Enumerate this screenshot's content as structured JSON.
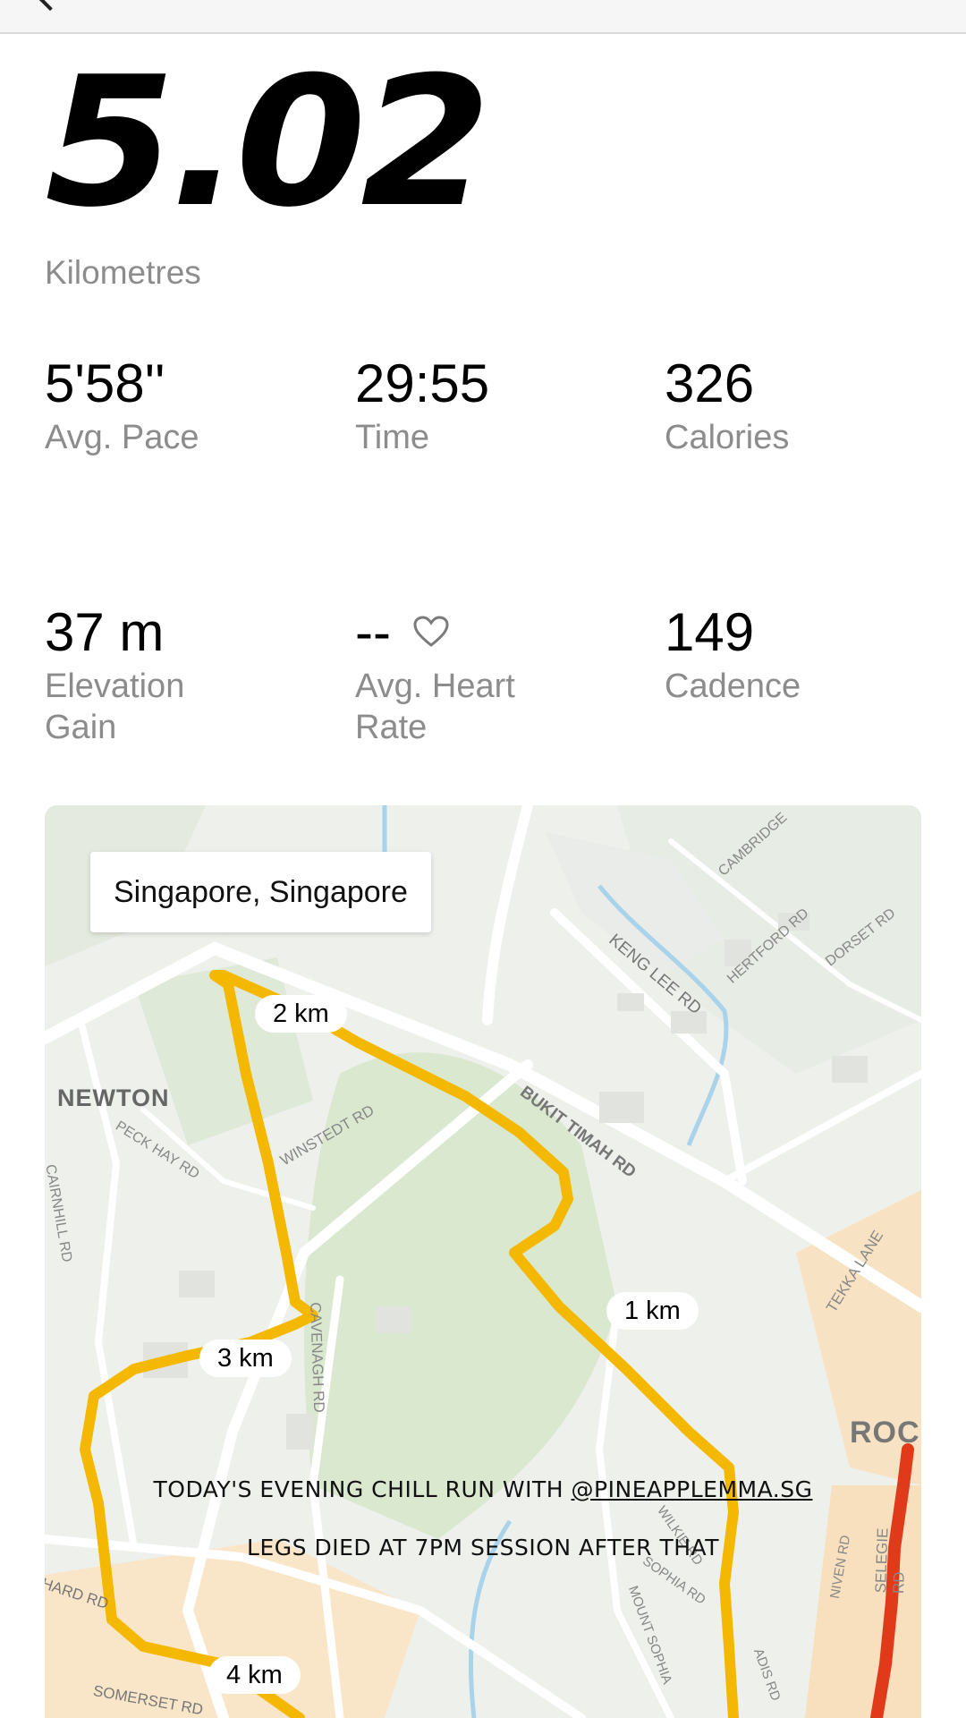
{
  "distance": {
    "value": "5.02",
    "unit": "Kilometres"
  },
  "stats": [
    {
      "value": "5'58''",
      "label": "Avg. Pace"
    },
    {
      "value": "29:55",
      "label": "Time"
    },
    {
      "value": "326",
      "label": "Calories"
    },
    {
      "value": "37 m",
      "label": "Elevation Gain"
    },
    {
      "value": "--",
      "label": "Avg. Heart Rate",
      "icon": "heart-outline-icon"
    },
    {
      "value": "149",
      "label": "Cadence"
    }
  ],
  "map": {
    "location": "Singapore, Singapore",
    "km_markers": [
      "1 km",
      "2 km",
      "3 km",
      "4 km"
    ],
    "area_labels": [
      "NEWTON",
      "ROCI"
    ],
    "road_labels": [
      "KENG LEE RD",
      "CAMBRIDGE",
      "HERTFORD RD",
      "DORSET RD",
      "BUKIT TIMAH RD",
      "WINSTEDT RD",
      "PECK HAY RD",
      "CAIRNHILL RD",
      "CAVENAGH RD",
      "TEKKA LANE",
      "SELEGIE RD",
      "NIVEN RD",
      "WILKIE RD",
      "SOPHIA RD",
      "MOUNT SOPHIA",
      "ADIS RD",
      "HARD RD",
      "SOMERSET RD"
    ],
    "route_color": "#f5b800"
  },
  "caption": {
    "line1_prefix": "TODAY'S EVENING CHILL RUN WITH ",
    "line1_handle": "@PINEAPPLEMMA.SG",
    "line2": "LEGS DIED AT 7PM SESSION AFTER THAT"
  }
}
